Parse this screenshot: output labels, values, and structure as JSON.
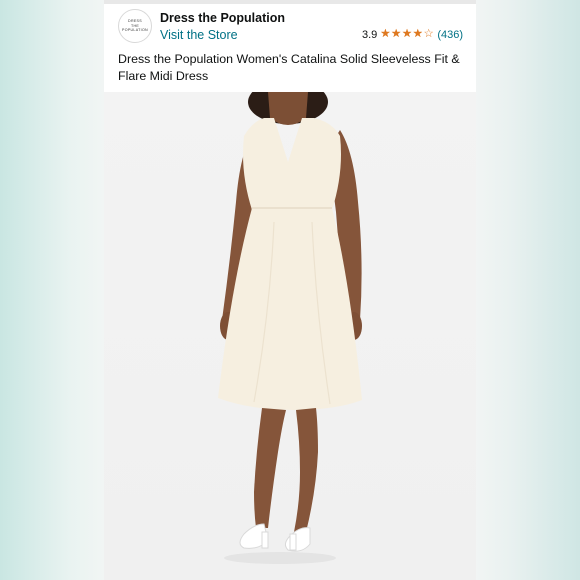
{
  "product": {
    "brand_logo_text": [
      "DRESS",
      "THE",
      "POPULATION"
    ],
    "brand_name": "Dress the Population",
    "store_link": "Visit the Store",
    "rating_value": "3.9",
    "rating_fraction": 0.78,
    "stars_icon": "star-rating-icon",
    "review_count": "(436)",
    "title": "Dress the Population Women's Catalina Solid Sleeveless Fit & Flare Midi Dress"
  },
  "colors": {
    "link": "#007185",
    "star": "#de7921",
    "dress": "#f6efe0",
    "skin": "#8a5a3e"
  }
}
